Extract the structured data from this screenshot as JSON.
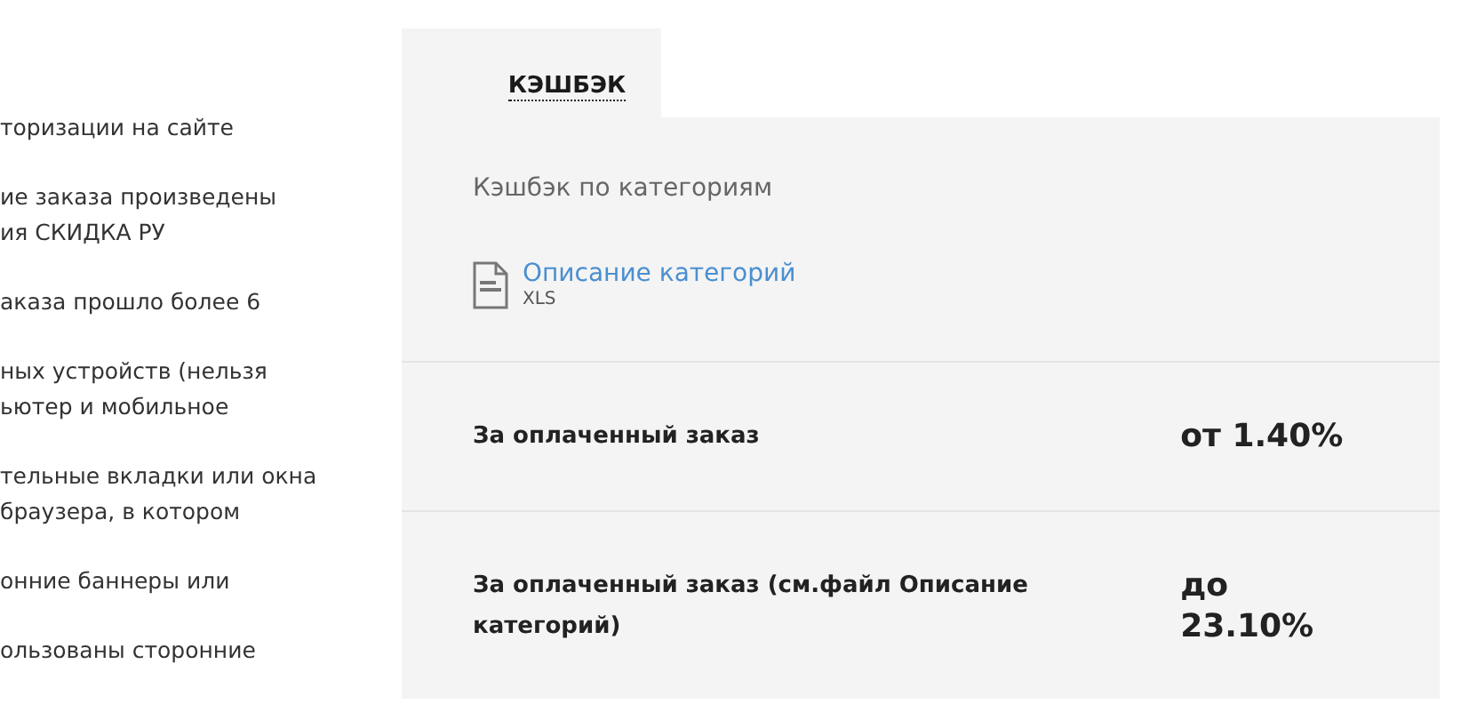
{
  "conditions": [
    {
      "lines": [
        "торизации на сайте"
      ]
    },
    {
      "lines": [
        "ие заказа произведены",
        "ия СКИДКА РУ"
      ]
    },
    {
      "lines": [
        "аказа прошло более 6"
      ]
    },
    {
      "lines": [
        "ных устройств (нельзя",
        "ьютер и мобильное"
      ]
    },
    {
      "lines": [
        "тельные вкладки или окна",
        " браузера, в котором"
      ]
    },
    {
      "lines": [
        "онние баннеры или"
      ]
    },
    {
      "lines": [
        "ользованы сторонние"
      ]
    }
  ],
  "tabs": [
    {
      "label": "КЭШБЭК",
      "selected": true
    }
  ],
  "panel": {
    "subtitle": "Кэшбэк по категориям",
    "file": {
      "title": "Описание категорий",
      "type": "XLS"
    },
    "rates": [
      {
        "label": "За оплаченный заказ",
        "value": "от 1.40%"
      },
      {
        "label": "За оплаченный заказ (см.файл Описание категорий)",
        "value": "до 23.10%"
      }
    ]
  }
}
